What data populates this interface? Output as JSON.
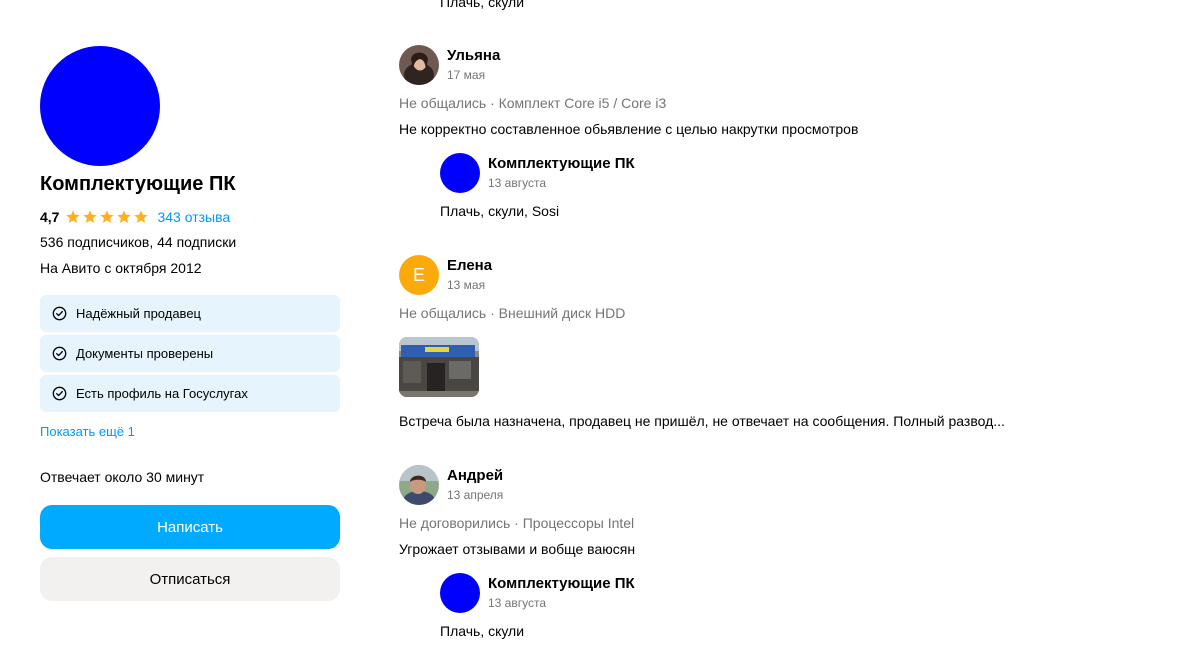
{
  "colors": {
    "seller_avatar": "#0000ff",
    "accent": "#00aaff",
    "link": "#0099f7",
    "star": "#ffb021",
    "badge_bg": "#e5f4fd",
    "secondary_button_bg": "#f2f1f0",
    "muted_text": "#757575"
  },
  "seller": {
    "name": "Комплектующие ПК",
    "rating": "4,7",
    "stars": 5,
    "reviews_link": "343 отзыва",
    "subscribers": "536 подписчиков, 44 подписки",
    "since": "На Авито с октября 2012",
    "badges": [
      {
        "icon": "check-circle-icon",
        "label": "Надёжный продавец"
      },
      {
        "icon": "check-circle-icon",
        "label": "Документы проверены"
      },
      {
        "icon": "check-circle-icon",
        "label": "Есть профиль на Госуслугах"
      }
    ],
    "show_more": "Показать ещё 1",
    "response_time": "Отвечает около 30 минут",
    "write_button": "Написать",
    "unsubscribe_button": "Отписаться"
  },
  "reviews": {
    "top_fragment": "Плачь, скули",
    "items": [
      {
        "author": "Ульяна",
        "date": "17 мая",
        "meta": "Не общались · Комплект Core i5 / Core i3",
        "text": "Не корректно составленное обьявление с целью накрутки просмотров",
        "reply": {
          "author": "Комплектующие ПК",
          "date": "13 августа",
          "text": "Плачь, скули, Sosi"
        }
      },
      {
        "author": "Елена",
        "avatar_letter": "Е",
        "date": "13 мая",
        "meta": "Не общались · Внешний диск HDD",
        "text": "Встреча была назначена, продавец не пришёл, не отвечает на сообщения. Полный развод..."
      },
      {
        "author": "Андрей",
        "date": "13 апреля",
        "meta": "Не договорились · Процессоры Intel",
        "text": "Угрожает отзывами и вобще ваюсян",
        "reply": {
          "author": "Комплектующие ПК",
          "date": "13 августа",
          "text": "Плачь, скули"
        }
      }
    ]
  }
}
